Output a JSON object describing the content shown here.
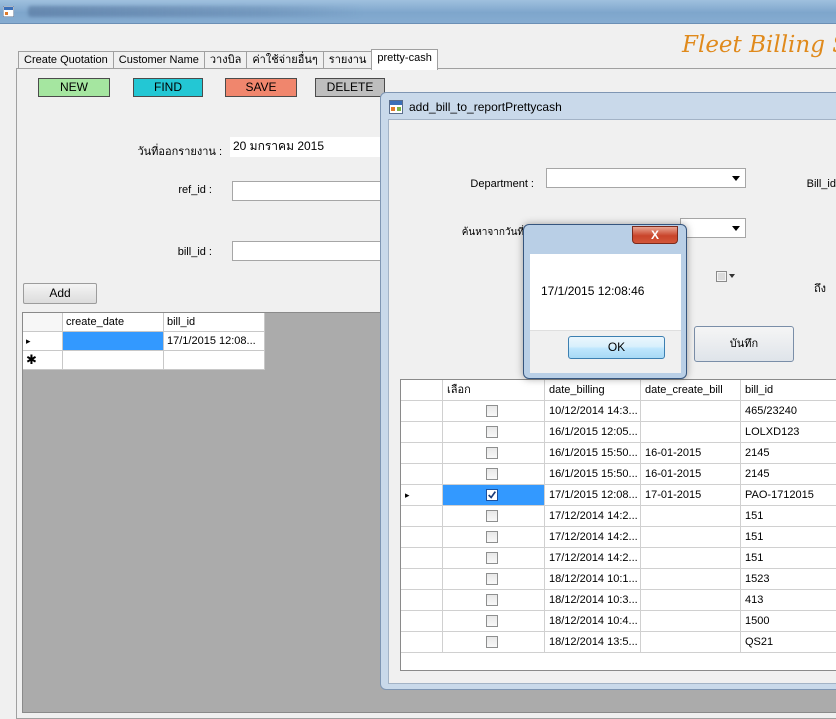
{
  "window": {
    "app_title": "Fleet Billing Sy"
  },
  "tabs": [
    {
      "label": "Create Quotation"
    },
    {
      "label": "Customer Name"
    },
    {
      "label": "วางบิล"
    },
    {
      "label": "ค่าใช้จ่ายอื่นๆ"
    },
    {
      "label": "รายงาน"
    },
    {
      "label": "pretty-cash",
      "active": true
    }
  ],
  "toolbar": {
    "new_label": "NEW",
    "find_label": "FIND",
    "save_label": "SAVE",
    "delete_label": "DELETE",
    "colors": {
      "new": "#a5e6a0",
      "find": "#23c7d4",
      "save": "#f0866d",
      "delete": "#bebebe"
    }
  },
  "form": {
    "report_date_label": "วันที่ออกรายงาน :",
    "report_date_value": "20  มกราคม  2015",
    "ref_id_label": "ref_id :",
    "ref_id_value": "",
    "bill_id_label": "bill_id :",
    "bill_id_value": "",
    "add_label": "Add"
  },
  "left_grid": {
    "columns": [
      "create_date",
      "bill_id"
    ],
    "rows": [
      {
        "create_date": "",
        "bill_id": "17/1/2015 12:08...",
        "current": true
      },
      {
        "create_date": "",
        "bill_id": "",
        "new_row": true
      }
    ],
    "current_marker": "▸",
    "new_marker": "✱"
  },
  "popup": {
    "title": "add_bill_to_reportPrettycash",
    "department_label": "Department :",
    "department_value": "",
    "bill_id_label": "Bill_id",
    "search_date_label": "ค้นหาจากวันที่",
    "to_label": "ถึง",
    "save_label": "บันทึก",
    "grid": {
      "columns": [
        "เลือก",
        "date_billing",
        "date_create_bill",
        "bill_id"
      ],
      "rows": [
        {
          "checked": false,
          "date_billing": "10/12/2014 14:3...",
          "date_create_bill": "",
          "bill_id": "465/23240"
        },
        {
          "checked": false,
          "date_billing": "16/1/2015 12:05...",
          "date_create_bill": "",
          "bill_id": "LOLXD123"
        },
        {
          "checked": false,
          "date_billing": "16/1/2015 15:50...",
          "date_create_bill": "16-01-2015",
          "bill_id": "2145"
        },
        {
          "checked": false,
          "date_billing": "16/1/2015 15:50...",
          "date_create_bill": "16-01-2015",
          "bill_id": "2145"
        },
        {
          "checked": true,
          "current": true,
          "date_billing": "17/1/2015 12:08...",
          "date_create_bill": "17-01-2015",
          "bill_id": "PAO-1712015"
        },
        {
          "checked": false,
          "date_billing": "17/12/2014 14:2...",
          "date_create_bill": "",
          "bill_id": "151"
        },
        {
          "checked": false,
          "date_billing": "17/12/2014 14:2...",
          "date_create_bill": "",
          "bill_id": "151"
        },
        {
          "checked": false,
          "date_billing": "17/12/2014 14:2...",
          "date_create_bill": "",
          "bill_id": "151"
        },
        {
          "checked": false,
          "date_billing": "18/12/2014 10:1...",
          "date_create_bill": "",
          "bill_id": "1523"
        },
        {
          "checked": false,
          "date_billing": "18/12/2014 10:3...",
          "date_create_bill": "",
          "bill_id": "413"
        },
        {
          "checked": false,
          "date_billing": "18/12/2014 10:4...",
          "date_create_bill": "",
          "bill_id": "1500"
        },
        {
          "checked": false,
          "date_billing": "18/12/2014 13:5...",
          "date_create_bill": "",
          "bill_id": "QS21"
        }
      ]
    }
  },
  "message_box": {
    "close_glyph": "X",
    "message": "17/1/2015 12:08:46",
    "ok_label": "OK"
  },
  "colors": {
    "selection": "#3399ff",
    "title_accent": "#e08a1c",
    "grid_background": "#ababab"
  }
}
